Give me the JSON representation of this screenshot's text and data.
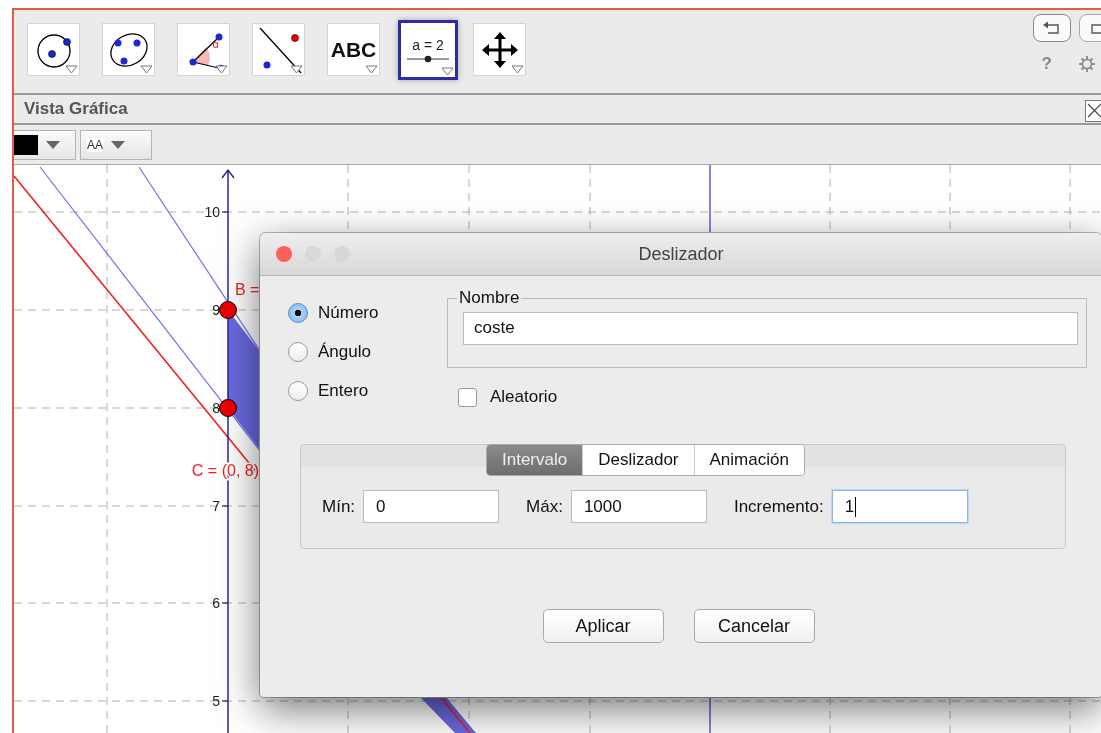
{
  "toolbar": {
    "tools": [
      {
        "kind": "circle",
        "selected": false
      },
      {
        "kind": "conic",
        "selected": false
      },
      {
        "kind": "angle",
        "label": "α",
        "selected": false
      },
      {
        "kind": "line-point",
        "selected": false
      },
      {
        "kind": "text",
        "label": "ABC",
        "selected": false
      },
      {
        "kind": "slider",
        "label": "a = 2",
        "selected": true
      },
      {
        "kind": "move",
        "selected": false
      }
    ],
    "help": "?"
  },
  "view": {
    "title": "Vista Gráfica"
  },
  "style_bar": {
    "color": "#000000",
    "text_style": "AA"
  },
  "graph": {
    "y_ticks": [
      "10",
      "9",
      "8",
      "7",
      "6",
      "5"
    ],
    "points": [
      {
        "label": "B ="
      },
      {
        "label": "C = (0, 8)"
      }
    ]
  },
  "dialog": {
    "title": "Deslizador",
    "window_buttons": [
      {
        "color": "#fc605b"
      },
      {
        "color": "#d8d8d8"
      },
      {
        "color": "#d8d8d8"
      }
    ],
    "types": [
      {
        "label": "Número",
        "selected": true
      },
      {
        "label": "Ángulo",
        "selected": false
      },
      {
        "label": "Entero",
        "selected": false
      }
    ],
    "name": {
      "legend": "Nombre",
      "value": "coste"
    },
    "random": {
      "label": "Aleatorio",
      "checked": false
    },
    "tabs": [
      {
        "label": "Intervalo",
        "selected": true
      },
      {
        "label": "Deslizador",
        "selected": false
      },
      {
        "label": "Animación",
        "selected": false
      }
    ],
    "fields": [
      {
        "label": "Mín:",
        "value": "0",
        "focused": false
      },
      {
        "label": "Máx:",
        "value": "1000",
        "focused": false
      },
      {
        "label": "Incremento:",
        "value": "1",
        "focused": true
      }
    ],
    "buttons": [
      "Aplicar",
      "Cancelar"
    ]
  }
}
